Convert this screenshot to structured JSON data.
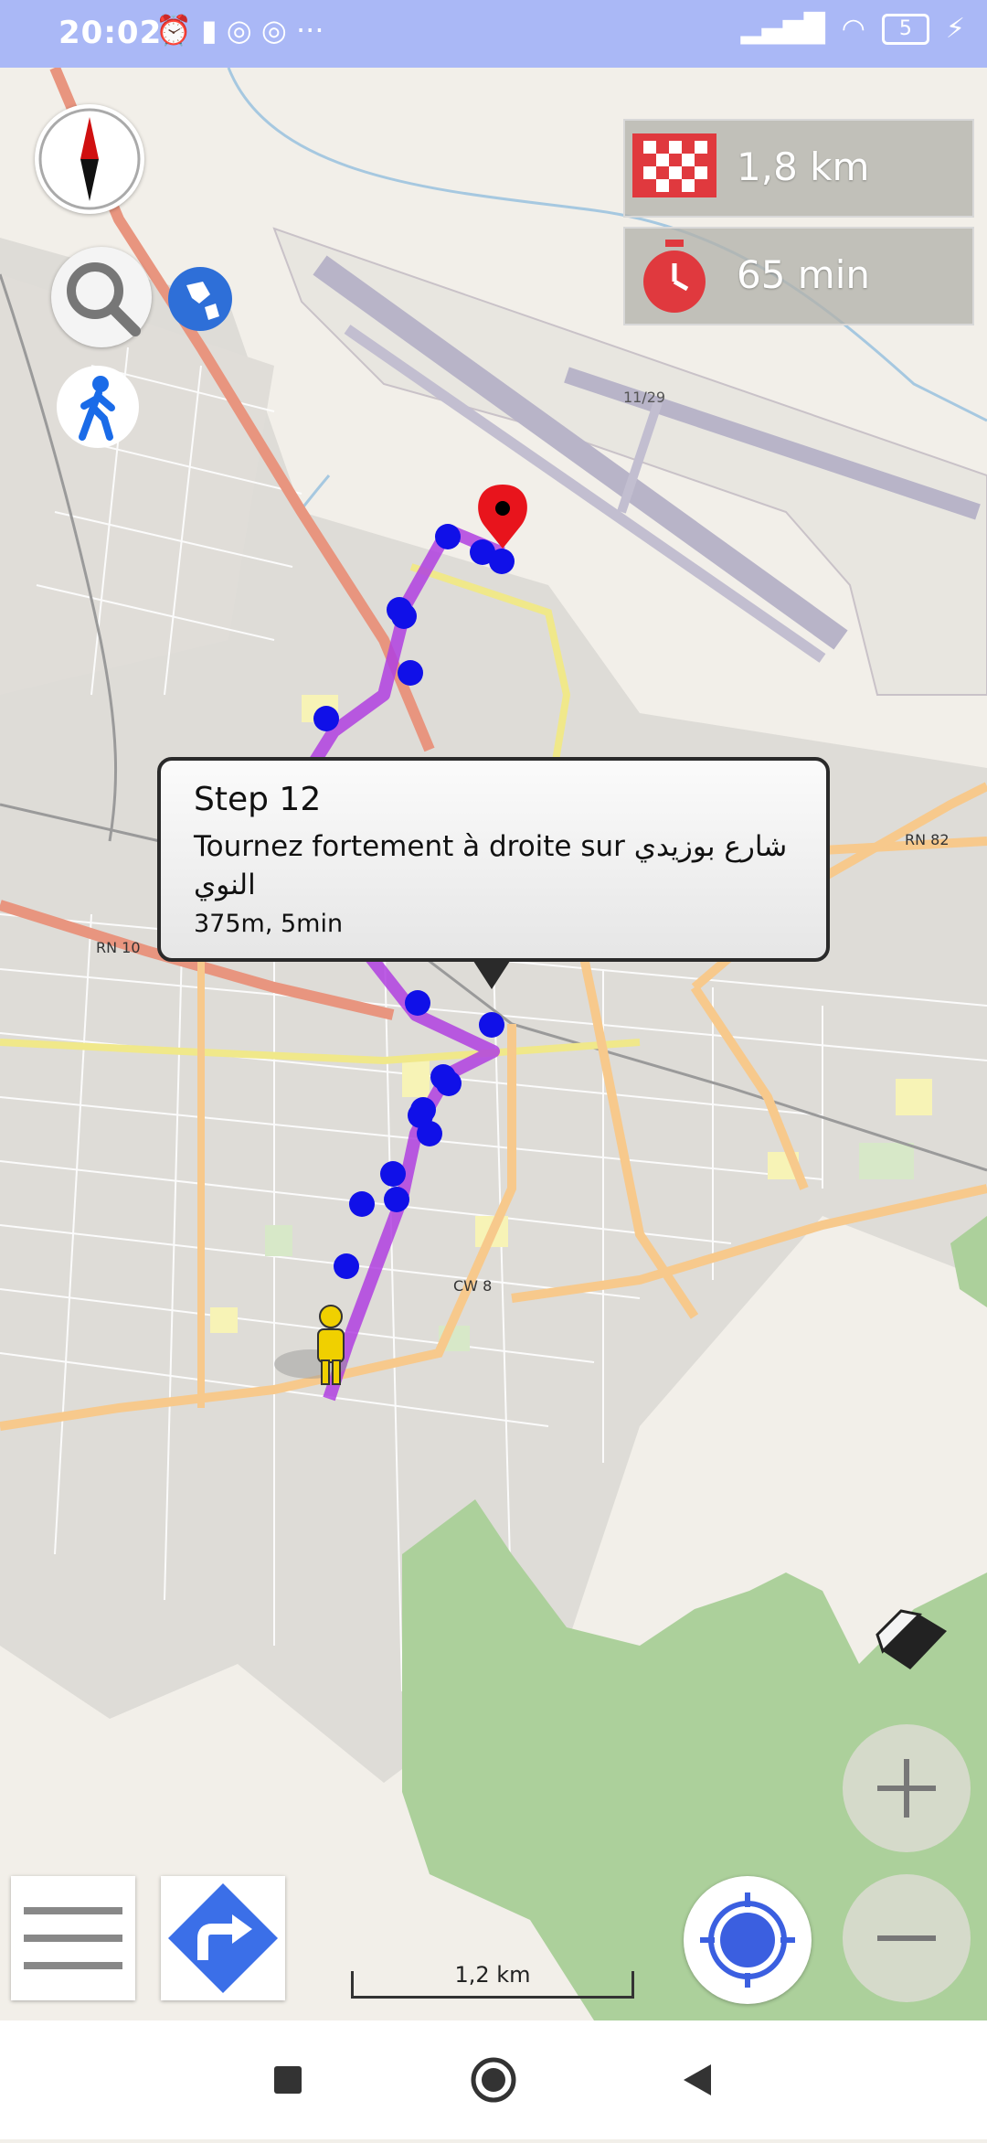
{
  "status_bar": {
    "time": "20:02",
    "icons_left": [
      "alarm-icon",
      "battery-saver-icon",
      "sync-icon",
      "sync-icon",
      "more-icon"
    ],
    "icons_right": [
      "signal-icon",
      "wifi-icon",
      "battery-icon",
      "charging-icon"
    ],
    "battery_level": "5"
  },
  "route_info": {
    "distance": "1,8 km",
    "duration": "65 min",
    "distance_icon": "checkered-flag-icon",
    "duration_icon": "stopwatch-icon"
  },
  "instruction": {
    "title": "Step 12",
    "text": "Tournez fortement à droite sur شارع بوزيدي النوي",
    "detail": "375m, 5min"
  },
  "map": {
    "scale_label": "1,2 km",
    "route_color": "#b040e0",
    "waypoint_color": "#1010e8",
    "labels": {
      "rn82": "RN 82",
      "rn10": "RN 10",
      "cw8": "CW 8",
      "runway": "11/29"
    }
  },
  "controls": {
    "compass": "compass-icon",
    "search": "search-icon",
    "globe": "globe-icon",
    "mode": "walking-icon",
    "eraser": "eraser-icon",
    "zoom_in": "plus-icon",
    "zoom_out": "minus-icon",
    "menu": "hamburger-menu-icon",
    "directions": "turn-right-sign-icon",
    "locate": "crosshair-location-icon"
  },
  "nav_bar": {
    "buttons": [
      "recent-apps-icon",
      "home-icon",
      "back-icon"
    ]
  }
}
